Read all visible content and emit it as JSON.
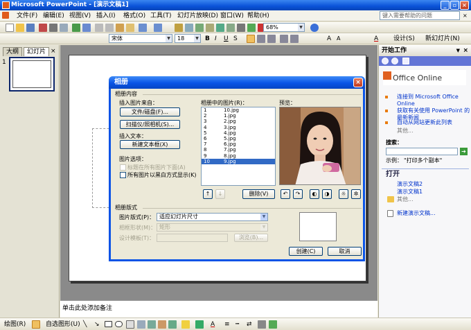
{
  "window": {
    "title": "Microsoft PowerPoint - [演示文稿1]"
  },
  "menu": {
    "items": [
      "文件(F)",
      "编辑(E)",
      "视图(V)",
      "插入(I)",
      "格式(O)",
      "工具(T)",
      "幻灯片放映(D)",
      "窗口(W)",
      "帮助(H)"
    ],
    "help_placeholder": "键入需要帮助的问题"
  },
  "toolbar": {
    "zoom": "68%",
    "font_name": "宋体",
    "font_size": "18",
    "design_label": "设计(S)",
    "new_slide_label": "新幻灯片(N)"
  },
  "left_pane": {
    "tab_outline": "大纲",
    "tab_slides": "幻灯片",
    "slide_number": "1"
  },
  "notes": {
    "placeholder": "单击此处添加备注"
  },
  "task_pane": {
    "title": "开始工作",
    "office_online": "Office Online",
    "links": [
      "连接到 Microsoft Office Online",
      "获取有关使用 PowerPoint 的最新新闻",
      "自动从网站更新此列表"
    ],
    "more1": "其他...",
    "search_label": "搜索：",
    "example_label": "示例：",
    "example_value": "\"打印多个副本\"",
    "open_title": "打开",
    "recent": [
      "演示文稿2",
      "演示文稿1"
    ],
    "more2": "其他...",
    "new_presentation": "新建演示文稿..."
  },
  "drawbar": {
    "draw_label": "绘图(R)",
    "autoshape_label": "自选图形(U)"
  },
  "dialog": {
    "title": "相册",
    "album_content": "相册内容",
    "insert_from": "插入图片来自：",
    "file_disk": "文件/磁盘(F)...",
    "scanner_camera": "扫描仪/照相机(S)...",
    "insert_text": "插入文本：",
    "new_textbox": "新建文本框(X)",
    "picture_options": "图片选项：",
    "caption_below": "标题在所有图片下面(A)",
    "all_bw": "所有图片以黑白方式显示(K)",
    "pictures_in_album": "相册中的图片(R)：",
    "pictures": [
      {
        "num": "1",
        "name": "10.jpg"
      },
      {
        "num": "2",
        "name": "1.jpg"
      },
      {
        "num": "3",
        "name": "2.jpg"
      },
      {
        "num": "4",
        "name": "3.jpg"
      },
      {
        "num": "5",
        "name": "4.jpg"
      },
      {
        "num": "6",
        "name": "5.jpg"
      },
      {
        "num": "7",
        "name": "6.jpg"
      },
      {
        "num": "8",
        "name": "7.jpg"
      },
      {
        "num": "9",
        "name": "8.jpg"
      },
      {
        "num": "10",
        "name": "9.jpg"
      }
    ],
    "selected_index": 9,
    "preview_label": "预览：",
    "move_up": "↑",
    "move_down": "↓",
    "remove": "删除(V)",
    "album_layout": "相册版式",
    "layout_label": "图片版式(P)：",
    "layout_value": "适应幻灯片尺寸",
    "frame_label": "相框形状(M)：",
    "frame_value": "矩形",
    "design_template_label": "设计模板(T)：",
    "browse": "浏览(B)...",
    "create": "创建(C)",
    "cancel": "取消"
  }
}
